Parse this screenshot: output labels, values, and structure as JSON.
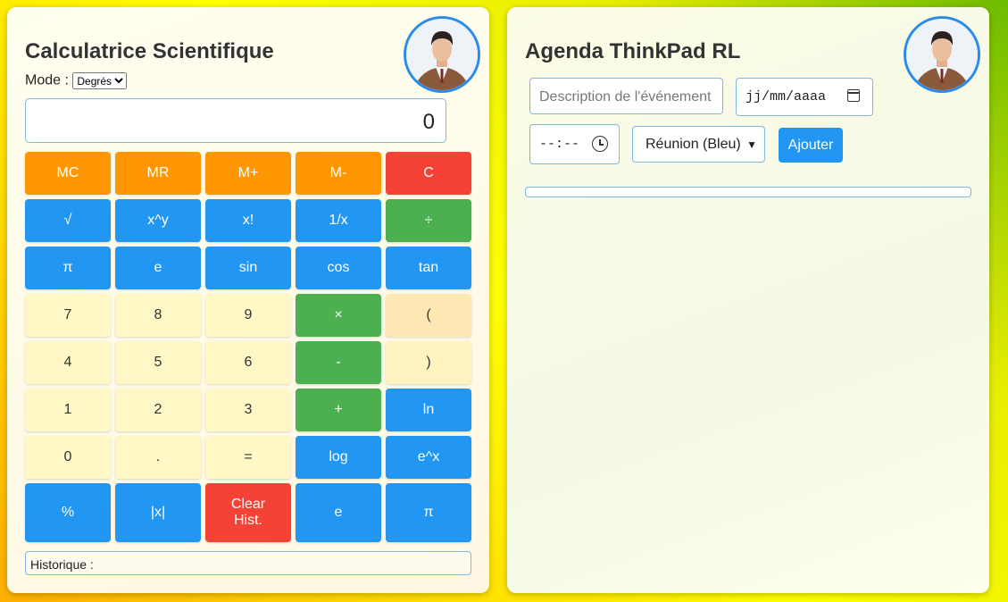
{
  "calculator": {
    "title": "Calculatrice Scientifique",
    "mode_label": "Mode :",
    "mode_value": "Degrés",
    "display_value": "0",
    "buttons": [
      {
        "label": "MC",
        "style": "orange"
      },
      {
        "label": "MR",
        "style": "orange"
      },
      {
        "label": "M+",
        "style": "orange"
      },
      {
        "label": "M-",
        "style": "orange"
      },
      {
        "label": "C",
        "style": "red"
      },
      {
        "label": "√",
        "style": "blue"
      },
      {
        "label": "x^y",
        "style": "blue"
      },
      {
        "label": "x!",
        "style": "blue"
      },
      {
        "label": "1/x",
        "style": "blue"
      },
      {
        "label": "÷",
        "style": "green"
      },
      {
        "label": "π",
        "style": "blue"
      },
      {
        "label": "e",
        "style": "blue"
      },
      {
        "label": "sin",
        "style": "blue"
      },
      {
        "label": "cos",
        "style": "blue"
      },
      {
        "label": "tan",
        "style": "blue"
      },
      {
        "label": "7",
        "style": "num"
      },
      {
        "label": "8",
        "style": "num"
      },
      {
        "label": "9",
        "style": "num"
      },
      {
        "label": "×",
        "style": "green"
      },
      {
        "label": "(",
        "style": "paren1"
      },
      {
        "label": "4",
        "style": "num"
      },
      {
        "label": "5",
        "style": "num"
      },
      {
        "label": "6",
        "style": "num"
      },
      {
        "label": "-",
        "style": "green"
      },
      {
        "label": ")",
        "style": "paren2"
      },
      {
        "label": "1",
        "style": "num"
      },
      {
        "label": "2",
        "style": "num"
      },
      {
        "label": "3",
        "style": "num"
      },
      {
        "label": "+",
        "style": "green"
      },
      {
        "label": "ln",
        "style": "blue"
      },
      {
        "label": "0",
        "style": "num"
      },
      {
        "label": ".",
        "style": "num"
      },
      {
        "label": "=",
        "style": "num"
      },
      {
        "label": "log",
        "style": "blue"
      },
      {
        "label": "e^x",
        "style": "blue"
      },
      {
        "label": "%",
        "style": "blue"
      },
      {
        "label": "|x|",
        "style": "blue"
      },
      {
        "label": "Clear Hist.",
        "style": "red"
      },
      {
        "label": "e",
        "style": "blue"
      },
      {
        "label": "π",
        "style": "blue"
      }
    ],
    "history_label": "Historique :"
  },
  "agenda": {
    "title": "Agenda ThinkPad RL",
    "description_placeholder": "Description de l'événement",
    "date_placeholder": "jj/mm/aaaa",
    "time_placeholder": "--:--",
    "category_value": "Réunion (Bleu)",
    "add_label": "Ajouter"
  },
  "colors": {
    "blue": "#2196f3",
    "green": "#4caf50",
    "orange": "#ff9800",
    "red": "#f44336",
    "number_key": "#fff8c6"
  },
  "icons": [
    "avatar-photo",
    "calendar-icon",
    "clock-icon",
    "chevron-down-icon"
  ]
}
